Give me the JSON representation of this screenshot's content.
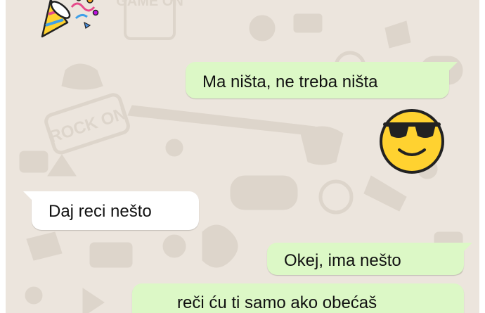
{
  "conversation": {
    "messages": [
      {
        "direction": "outgoing",
        "text": "Ma ništa, ne treba ništa"
      },
      {
        "direction": "outgoing",
        "emoji": "smiling-face-with-sunglasses-emoji"
      },
      {
        "direction": "incoming",
        "text": "Daj reci nešto"
      },
      {
        "direction": "outgoing",
        "text": "Okej, ima nešto"
      },
      {
        "direction": "outgoing",
        "text": "reči ću ti samo ako obećaš"
      }
    ],
    "top_sticker": "party-popper-emoji"
  },
  "wallpaper": {
    "labels": [
      "GAME ON",
      "ROCK ON"
    ],
    "colors": {
      "background": "#ece5dd",
      "doodle": "#ddd5cb"
    }
  },
  "colors": {
    "outgoing_bubble": "#dcf8c6",
    "incoming_bubble": "#ffffff"
  }
}
